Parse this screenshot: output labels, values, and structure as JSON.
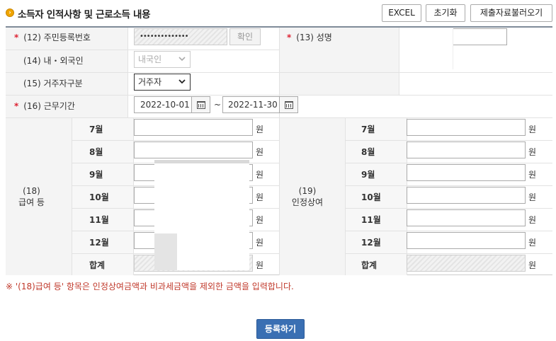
{
  "header": {
    "title": "소득자 인적사항 및 근로소득 내용",
    "buttons": {
      "excel": "EXCEL",
      "reset": "초기화",
      "load": "제출자료불러오기"
    }
  },
  "form": {
    "required_mark": "*",
    "resident_no": {
      "label": "(12) 주민등록번호",
      "value": "••••••••••••••",
      "confirm_label": "확인"
    },
    "name": {
      "label": "(13) 성명"
    },
    "nationality": {
      "label": "(14) 내・외국인",
      "selected": "내국인"
    },
    "residency": {
      "label": "(15) 거주자구분",
      "selected": "거주자"
    },
    "period": {
      "label": "(16) 근무기간",
      "start": "2022-10-01",
      "end": "2022-11-30",
      "separator": "~"
    }
  },
  "salary": {
    "group_label_line1": "(18)",
    "group_label_line2": "급여 등",
    "unit": "원",
    "rows": [
      {
        "month": "7월"
      },
      {
        "month": "8월"
      },
      {
        "month": "9월"
      },
      {
        "month": "10월"
      },
      {
        "month": "11월"
      },
      {
        "month": "12월"
      },
      {
        "month": "합계"
      }
    ]
  },
  "bonus": {
    "group_label_line1": "(19)",
    "group_label_line2": "인정상여",
    "unit": "원",
    "rows": [
      {
        "month": "7월"
      },
      {
        "month": "8월"
      },
      {
        "month": "9월"
      },
      {
        "month": "10월"
      },
      {
        "month": "11월"
      },
      {
        "month": "12월"
      },
      {
        "month": "합계"
      }
    ]
  },
  "note": "※ '(18)급여 등' 항목은 인정상여금액과 비과세금액을 제외한 금액을 입력합니다.",
  "submit_label": "등록하기",
  "colors": {
    "accent": "#3a6fb3",
    "required": "#d22233",
    "note": "#c0392b"
  }
}
